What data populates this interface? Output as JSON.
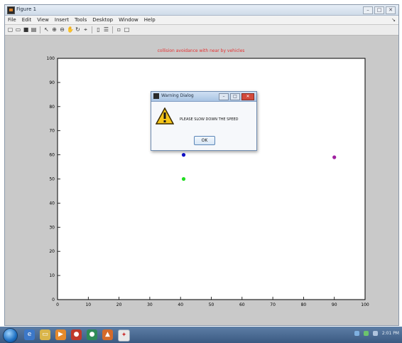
{
  "window": {
    "title": "Figure 1",
    "menus": [
      "File",
      "Edit",
      "View",
      "Insert",
      "Tools",
      "Desktop",
      "Window",
      "Help"
    ],
    "menu_more": "↘",
    "controls": [
      "–",
      "□",
      "✕"
    ]
  },
  "toolbar": {
    "icons": [
      "new-figure-icon",
      "open-icon",
      "save-icon",
      "print-icon",
      "pointer-icon",
      "zoom-in-icon",
      "zoom-out-icon",
      "pan-icon",
      "rotate-icon",
      "data-cursor-icon",
      "colorbar-icon",
      "legend-icon",
      "hide-plot-tools-icon",
      "show-plot-tools-icon"
    ]
  },
  "chart_data": {
    "type": "scatter",
    "title": "collision avoidance with near by vehicles",
    "xlim": [
      0,
      100
    ],
    "ylim": [
      0,
      100
    ],
    "xticks": [
      0,
      10,
      20,
      30,
      40,
      50,
      60,
      70,
      80,
      90,
      100
    ],
    "yticks": [
      0,
      10,
      20,
      30,
      40,
      50,
      60,
      70,
      80,
      90,
      100
    ],
    "grid": false,
    "series": [
      {
        "x": [
          41
        ],
        "y": [
          60
        ],
        "color": "#1010c8"
      },
      {
        "x": [
          41
        ],
        "y": [
          50
        ],
        "color": "#22dd22"
      },
      {
        "x": [
          90
        ],
        "y": [
          59
        ],
        "color": "#a020a0"
      }
    ]
  },
  "dialog": {
    "title": "Warning Dialog",
    "message": "PLEASE SLOW DOWN THE SPEED",
    "ok_label": "OK",
    "controls": [
      "–",
      "□",
      "✕"
    ]
  },
  "taskbar": {
    "clock": "2:01 PM"
  }
}
